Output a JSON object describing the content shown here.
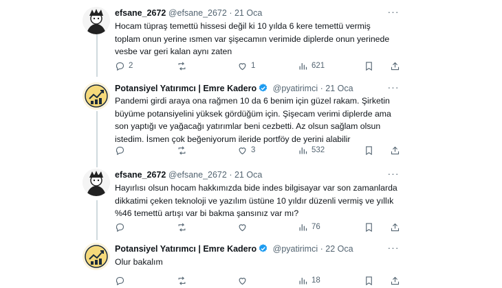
{
  "tweets": [
    {
      "name": "efsane_2672",
      "handle": "@efsane_2672",
      "sep": "·",
      "date": "21 Oca",
      "verified": false,
      "text": "Hocam tüpraş temettü hissesi değil ki 10 yılda 6 kere temettü vermiş\ntoplam onun yerine ısmen var şişecamın verimide diplerde onun yerinede\nvesbe var geri kalan aynı zaten",
      "replies": "2",
      "retweets": "",
      "likes": "1",
      "views": "621"
    },
    {
      "name": "Potansiyel Yatırımcı | Emre Kadero",
      "handle": "@pyatirimci",
      "sep": "·",
      "date": "21 Oca",
      "verified": true,
      "text": "Pandemi girdi araya ona rağmen 10 da 6 benim için güzel rakam. Şirketin\nbüyüme potansiyelini yüksek gördüğüm için. Şişecam verimi diplerde ama\nson yaptığı ve yağacağı yatırımlar beni cezbetti. Az olsun sağlam olsun\nistedim. İsmen çok beğeniyorum ileride portföy de yerini alabilir",
      "replies": "",
      "retweets": "",
      "likes": "3",
      "views": "532"
    },
    {
      "name": "efsane_2672",
      "handle": "@efsane_2672",
      "sep": "·",
      "date": "21 Oca",
      "verified": false,
      "text": "Hayırlısı olsun hocam hakkımızda bide indes bilgisayar var son zamanlarda\ndikkatimi çeken teknoloji ve yazılım üstüne 10 yıldır düzenli vermiş ve yıllık\n%46 temettü artışı var bi bakma şansınız var mı?",
      "replies": "",
      "retweets": "",
      "likes": "",
      "views": "76"
    },
    {
      "name": "Potansiyel Yatırımcı | Emre Kadero",
      "handle": "@pyatirimci",
      "sep": "·",
      "date": "22 Oca",
      "verified": true,
      "text": "Olur bakalım",
      "replies": "",
      "retweets": "",
      "likes": "",
      "views": "18"
    }
  ],
  "icons": {
    "reply": "reply-icon",
    "retweet": "retweet-icon",
    "like": "heart-icon",
    "views": "views-icon",
    "bookmark": "bookmark-icon",
    "share": "share-icon",
    "more": "more-icon",
    "verified": "verified-badge-icon"
  },
  "colors": {
    "verified": "#1d9bf0",
    "secondary_text": "#536471",
    "thread_line": "#cfd9de"
  }
}
